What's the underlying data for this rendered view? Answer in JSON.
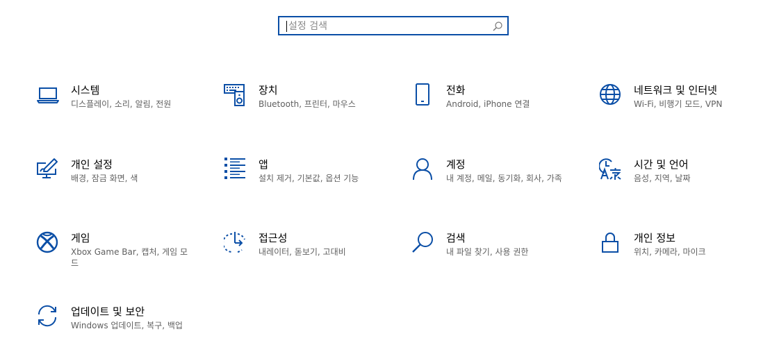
{
  "search": {
    "placeholder": "설정 검색"
  },
  "tiles": [
    {
      "title": "시스템",
      "desc": "디스플레이, 소리, 알림, 전원"
    },
    {
      "title": "장치",
      "desc": "Bluetooth, 프린터, 마우스"
    },
    {
      "title": "전화",
      "desc": "Android, iPhone 연결"
    },
    {
      "title": "네트워크 및 인터넷",
      "desc": "Wi-Fi, 비행기 모드, VPN"
    },
    {
      "title": "개인 설정",
      "desc": "배경, 잠금 화면, 색"
    },
    {
      "title": "앱",
      "desc": "설치 제거, 기본값, 옵션 기능"
    },
    {
      "title": "계정",
      "desc": "내 계정, 메일, 동기화, 회사, 가족"
    },
    {
      "title": "시간 및 언어",
      "desc": "음성, 지역, 날짜"
    },
    {
      "title": "게임",
      "desc": "Xbox Game Bar, 캡처, 게임 모드"
    },
    {
      "title": "접근성",
      "desc": "내레이터, 돋보기, 고대비"
    },
    {
      "title": "검색",
      "desc": "내 파일 찾기, 사용 권한"
    },
    {
      "title": "개인 정보",
      "desc": "위치, 카메라, 마이크"
    },
    {
      "title": "업데이트 및 보안",
      "desc": "Windows 업데이트, 복구, 백업"
    }
  ],
  "icons": [
    "laptop-icon",
    "keyboard-speaker-icon",
    "phone-icon",
    "globe-icon",
    "pen-monitor-icon",
    "app-list-icon",
    "person-icon",
    "time-language-icon",
    "xbox-icon",
    "ease-of-access-icon",
    "search-icon",
    "lock-icon",
    "sync-icon"
  ],
  "accent_color": "#0a4ea6"
}
